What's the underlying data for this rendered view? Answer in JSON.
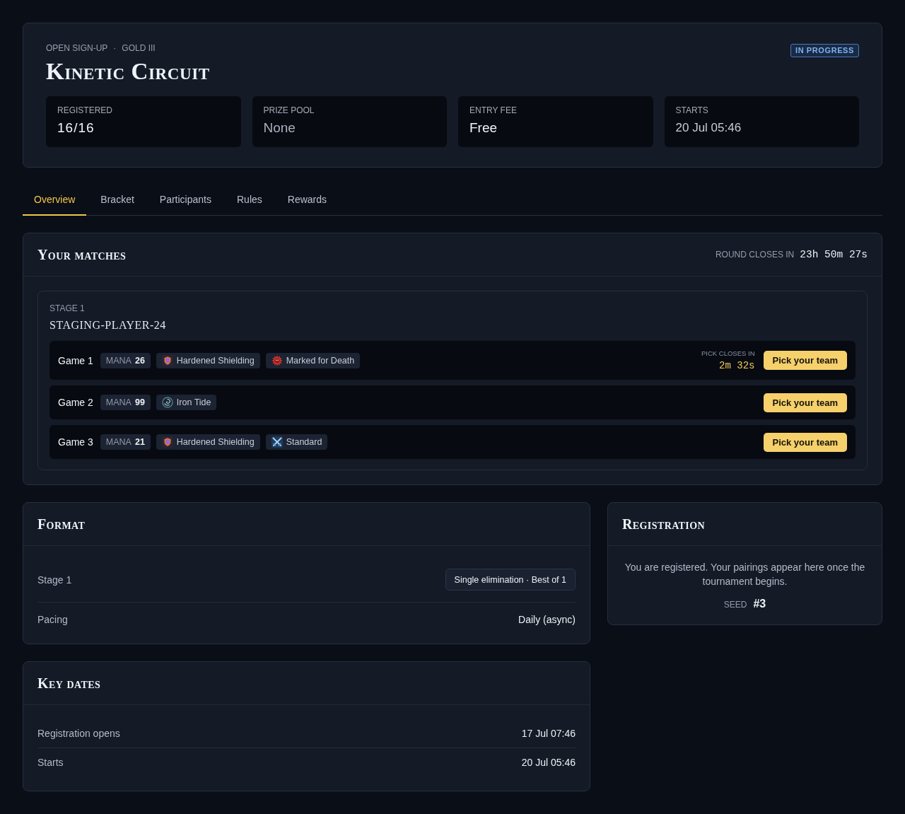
{
  "header": {
    "meta": [
      {
        "text": "OPEN SIGN-UP"
      },
      {
        "text": "GOLD III"
      }
    ],
    "separator": "·",
    "title": "Kinetic Circuit",
    "status": "IN PROGRESS",
    "stats": [
      {
        "label": "REGISTERED",
        "value": "16/16",
        "kind": "count"
      },
      {
        "label": "PRIZE POOL",
        "value": "None",
        "kind": "empty"
      },
      {
        "label": "ENTRY FEE",
        "value": "Free",
        "kind": "text"
      },
      {
        "label": "STARTS",
        "value": "20 Jul 05:46",
        "kind": "date"
      }
    ]
  },
  "tabs": [
    {
      "label": "Overview",
      "selected": true
    },
    {
      "label": "Bracket",
      "selected": false
    },
    {
      "label": "Participants",
      "selected": false
    },
    {
      "label": "Rules",
      "selected": false
    },
    {
      "label": "Rewards",
      "selected": false
    }
  ],
  "matches": {
    "title": "Your matches",
    "deadline_label": "ROUND CLOSES IN",
    "deadline": "23h 50m 27s",
    "stage": {
      "label": "STAGE 1",
      "opponent": "STAGING-PLAYER-24",
      "games": [
        {
          "name": "Game 1",
          "mana_label": "MANA",
          "mana": "26",
          "modifiers": [
            {
              "kind": "shield",
              "label": "Hardened Shielding"
            },
            {
              "kind": "mark",
              "label": "Marked for Death"
            }
          ],
          "pick_label": "PICK CLOSES IN",
          "pick_deadline": "2m 32s",
          "action": "Pick your team"
        },
        {
          "name": "Game 2",
          "mana_label": "MANA",
          "mana": "99",
          "modifiers": [
            {
              "kind": "tide",
              "label": "Iron Tide"
            }
          ],
          "action": "Pick your team"
        },
        {
          "name": "Game 3",
          "mana_label": "MANA",
          "mana": "21",
          "modifiers": [
            {
              "kind": "shield",
              "label": "Hardened Shielding"
            },
            {
              "kind": "swords",
              "label": "Standard"
            }
          ],
          "action": "Pick your team"
        }
      ]
    }
  },
  "format": {
    "title": "Format",
    "rows": [
      {
        "label": "Stage 1",
        "value": "Single elimination · Best of 1",
        "kind": "pill"
      },
      {
        "label": "Pacing",
        "value": "Daily (async)",
        "kind": "plain"
      }
    ]
  },
  "key_dates": {
    "title": "Key dates",
    "rows": [
      {
        "label": "Registration opens",
        "value": "17 Jul 07:46"
      },
      {
        "label": "Starts",
        "value": "20 Jul 05:46"
      }
    ]
  },
  "registration": {
    "title": "Registration",
    "message": "You are registered. Your pairings appear here once the tournament begins.",
    "seed_label": "SEED",
    "seed": "#3"
  }
}
